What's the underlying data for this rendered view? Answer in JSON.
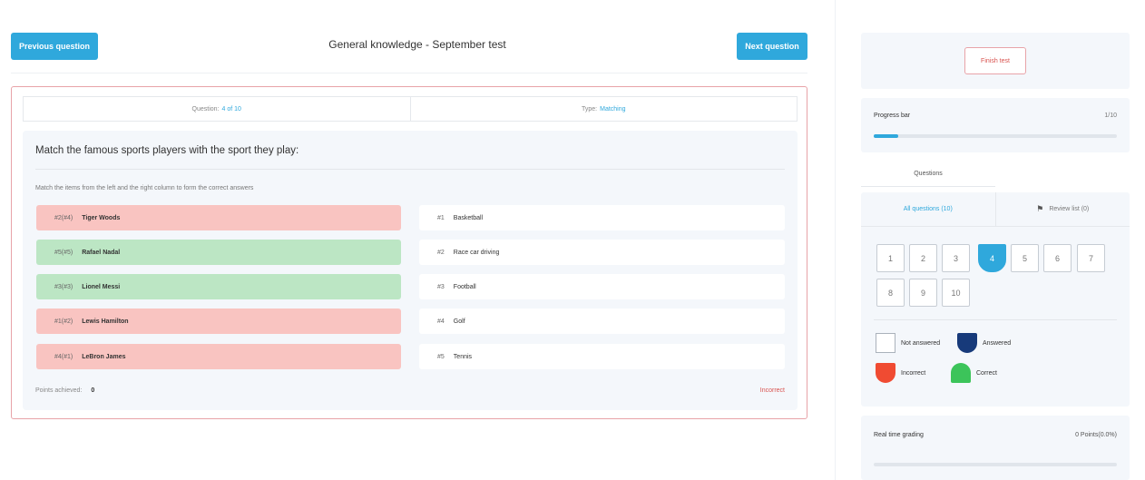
{
  "header": {
    "prev_label": "Previous question",
    "next_label": "Next question",
    "title": "General knowledge - September test"
  },
  "question_info": {
    "question_label": "Question:",
    "question_value": "4 of 10",
    "type_label": "Type:",
    "type_value": "Matching"
  },
  "question": {
    "text": "Match the famous sports players with the sport they play:",
    "instruction": "Match the items from the left and the right column to form the correct answers",
    "left_items": [
      {
        "code": "#2(#4)",
        "name": "Tiger Woods",
        "status": "red"
      },
      {
        "code": "#5(#5)",
        "name": "Rafael Nadal",
        "status": "green"
      },
      {
        "code": "#3(#3)",
        "name": "Lionel Messi",
        "status": "green"
      },
      {
        "code": "#1(#2)",
        "name": "Lewis Hamilton",
        "status": "red"
      },
      {
        "code": "#4(#1)",
        "name": "LeBron James",
        "status": "red"
      }
    ],
    "right_items": [
      {
        "num": "#1",
        "label": "Basketball"
      },
      {
        "num": "#2",
        "label": "Race car driving"
      },
      {
        "num": "#3",
        "label": "Football"
      },
      {
        "num": "#4",
        "label": "Golf"
      },
      {
        "num": "#5",
        "label": "Tennis"
      }
    ],
    "points_label": "Points achieved:",
    "points_value": "0",
    "result_label": "Incorrect"
  },
  "sidebar": {
    "finish_label": "Finish test",
    "progress_label": "Progress bar",
    "progress_count": "1/10",
    "progress_fraction": 0.1,
    "questions_tab": "Questions",
    "all_questions_tab": "All questions (10)",
    "review_tab": "Review list (0)",
    "numbers": [
      "1",
      "2",
      "3",
      "4",
      "5",
      "6",
      "7",
      "8",
      "9",
      "10"
    ],
    "active_number": "4",
    "legend": {
      "not_answered": "Not answered",
      "answered": "Answered",
      "incorrect": "Incorrect",
      "correct": "Correct"
    },
    "grading_label": "Real time grading",
    "grading_value": "0 Points(0.0%)"
  },
  "colors": {
    "accent": "#2fa8dc",
    "incorrect": "#f9c4c1",
    "correct": "#bce6c4"
  }
}
